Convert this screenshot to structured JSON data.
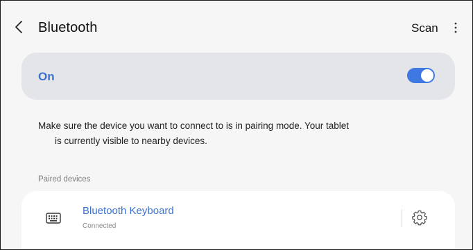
{
  "header": {
    "title": "Bluetooth",
    "scan_label": "Scan",
    "back_icon": "back-chevron-icon",
    "more_icon": "more-vertical-icon"
  },
  "bluetooth_toggle": {
    "label": "On",
    "state": "on",
    "accent_color": "#3f78e0"
  },
  "info": {
    "line1": "Make sure the device you want to connect to is in pairing mode. Your tablet",
    "line2": "is currently visible to nearby devices."
  },
  "paired_section": {
    "label": "Paired devices",
    "devices": [
      {
        "name": "Bluetooth Keyboard",
        "status": "Connected",
        "icon": "keyboard-icon",
        "settings_icon": "gear-icon"
      }
    ]
  }
}
